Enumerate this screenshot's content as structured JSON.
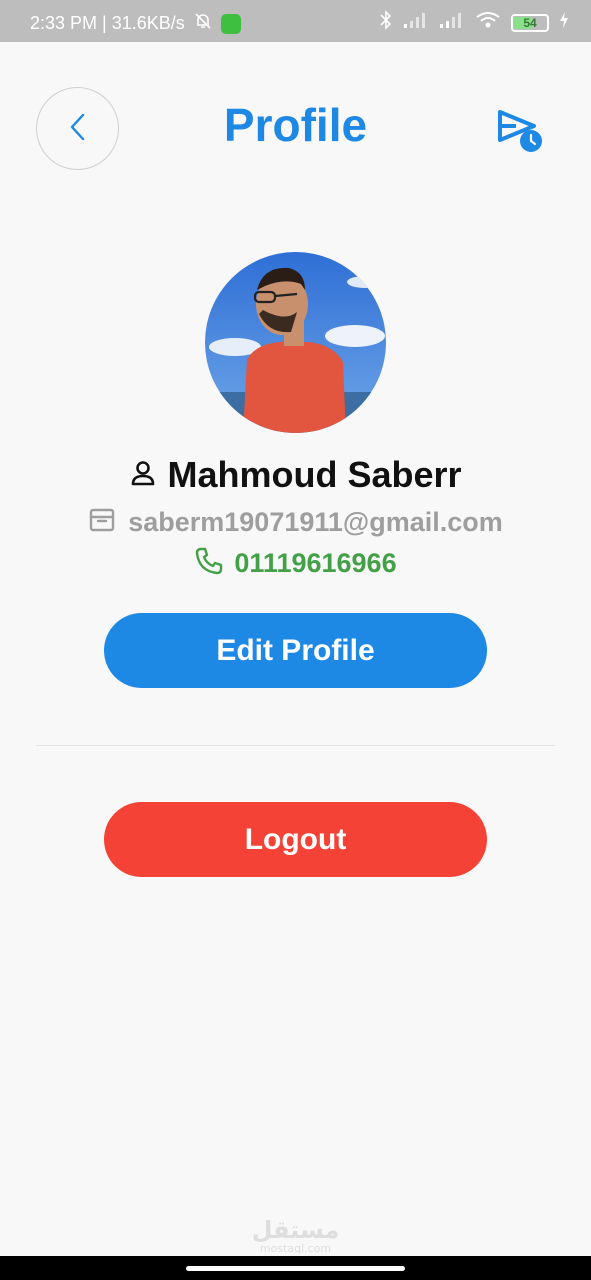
{
  "status_bar": {
    "time_speed": "2:33 PM | 31.6KB/s",
    "battery_level": "54"
  },
  "header": {
    "title": "Profile"
  },
  "profile": {
    "name": "Mahmoud Saberr",
    "email": "saberm19071911@gmail.com",
    "phone": "01119616966"
  },
  "actions": {
    "edit_label": "Edit Profile",
    "logout_label": "Logout"
  },
  "watermark": {
    "main": "مستقل",
    "sub": "mostaql.com"
  },
  "colors": {
    "primary": "#1e88e5",
    "danger": "#f44336",
    "success": "#43a047",
    "muted": "#9e9e9e"
  },
  "icons": {
    "back": "chevron-left-icon",
    "scheduled_send": "scheduled-send-icon",
    "person": "person-icon",
    "email": "mailbox-icon",
    "phone": "phone-icon"
  }
}
